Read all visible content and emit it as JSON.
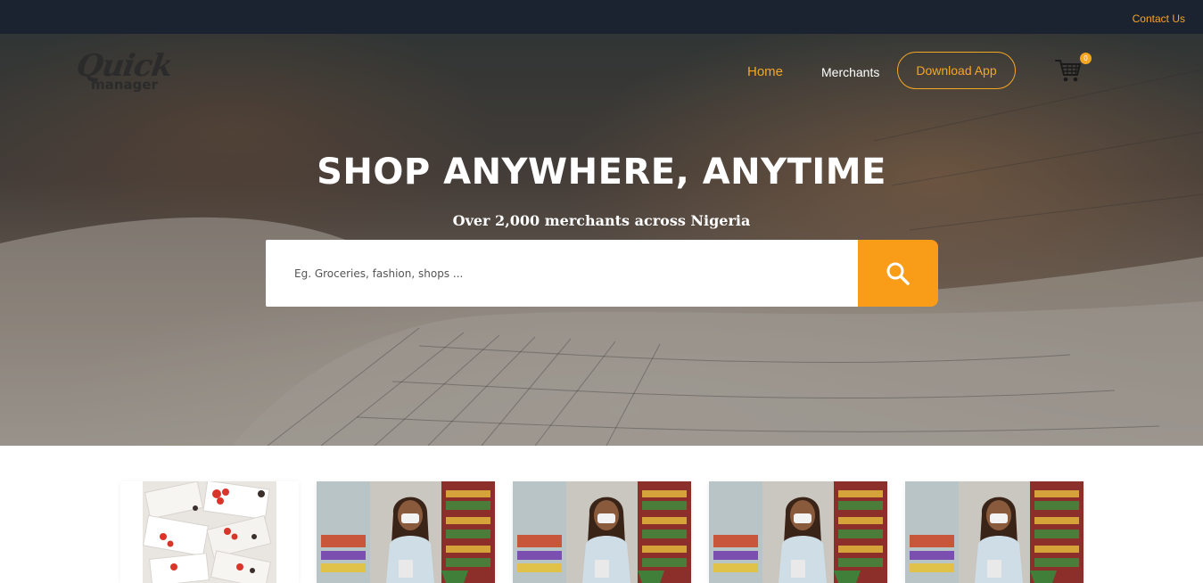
{
  "topbar": {
    "contact_label": "Contact Us"
  },
  "brand": {
    "logo_top": "Quick",
    "logo_bottom": "manager"
  },
  "nav": {
    "home_label": "Home",
    "merchants_label": "Merchants",
    "download_label": "Download App",
    "cart_icon": "shopping-cart-icon",
    "cart_count": "0"
  },
  "hero": {
    "title": "SHOP ANYWHERE, ANYTIME",
    "subtitle": "Over 2,000 merchants across Nigeria"
  },
  "search": {
    "placeholder": "Eg. Groceries, fashion, shops ...",
    "value": "",
    "button_icon": "search-icon"
  },
  "colors": {
    "accent": "#f5a623",
    "search_button": "#f99d18",
    "topbar_bg": "#1b2230"
  },
  "cards": [
    {
      "image": "product-packaging-image"
    },
    {
      "image": "shopper-grocery-image"
    },
    {
      "image": "shopper-grocery-image"
    },
    {
      "image": "shopper-grocery-image"
    },
    {
      "image": "shopper-grocery-image"
    }
  ]
}
